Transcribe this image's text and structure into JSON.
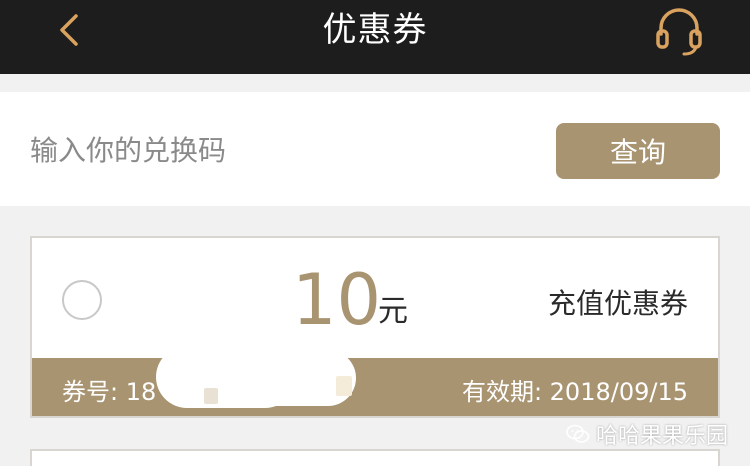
{
  "header": {
    "title": "优惠券",
    "back_icon": "chevron-left-icon",
    "support_icon": "headset-icon",
    "accent_color": "#d9a35f"
  },
  "redeem": {
    "placeholder": "输入你的兑换码",
    "query_label": "查询"
  },
  "coupons": [
    {
      "amount": "10",
      "unit": "元",
      "type": "充值优惠券",
      "number_label": "券号: 18",
      "expiry_label": "有效期: 2018/09/15"
    }
  ],
  "watermark": {
    "text": "哈哈果果乐园",
    "icon": "wechat-icon"
  },
  "colors": {
    "topbar": "#1d1d1d",
    "gold": "#a99472",
    "background": "#f1f1f1"
  }
}
